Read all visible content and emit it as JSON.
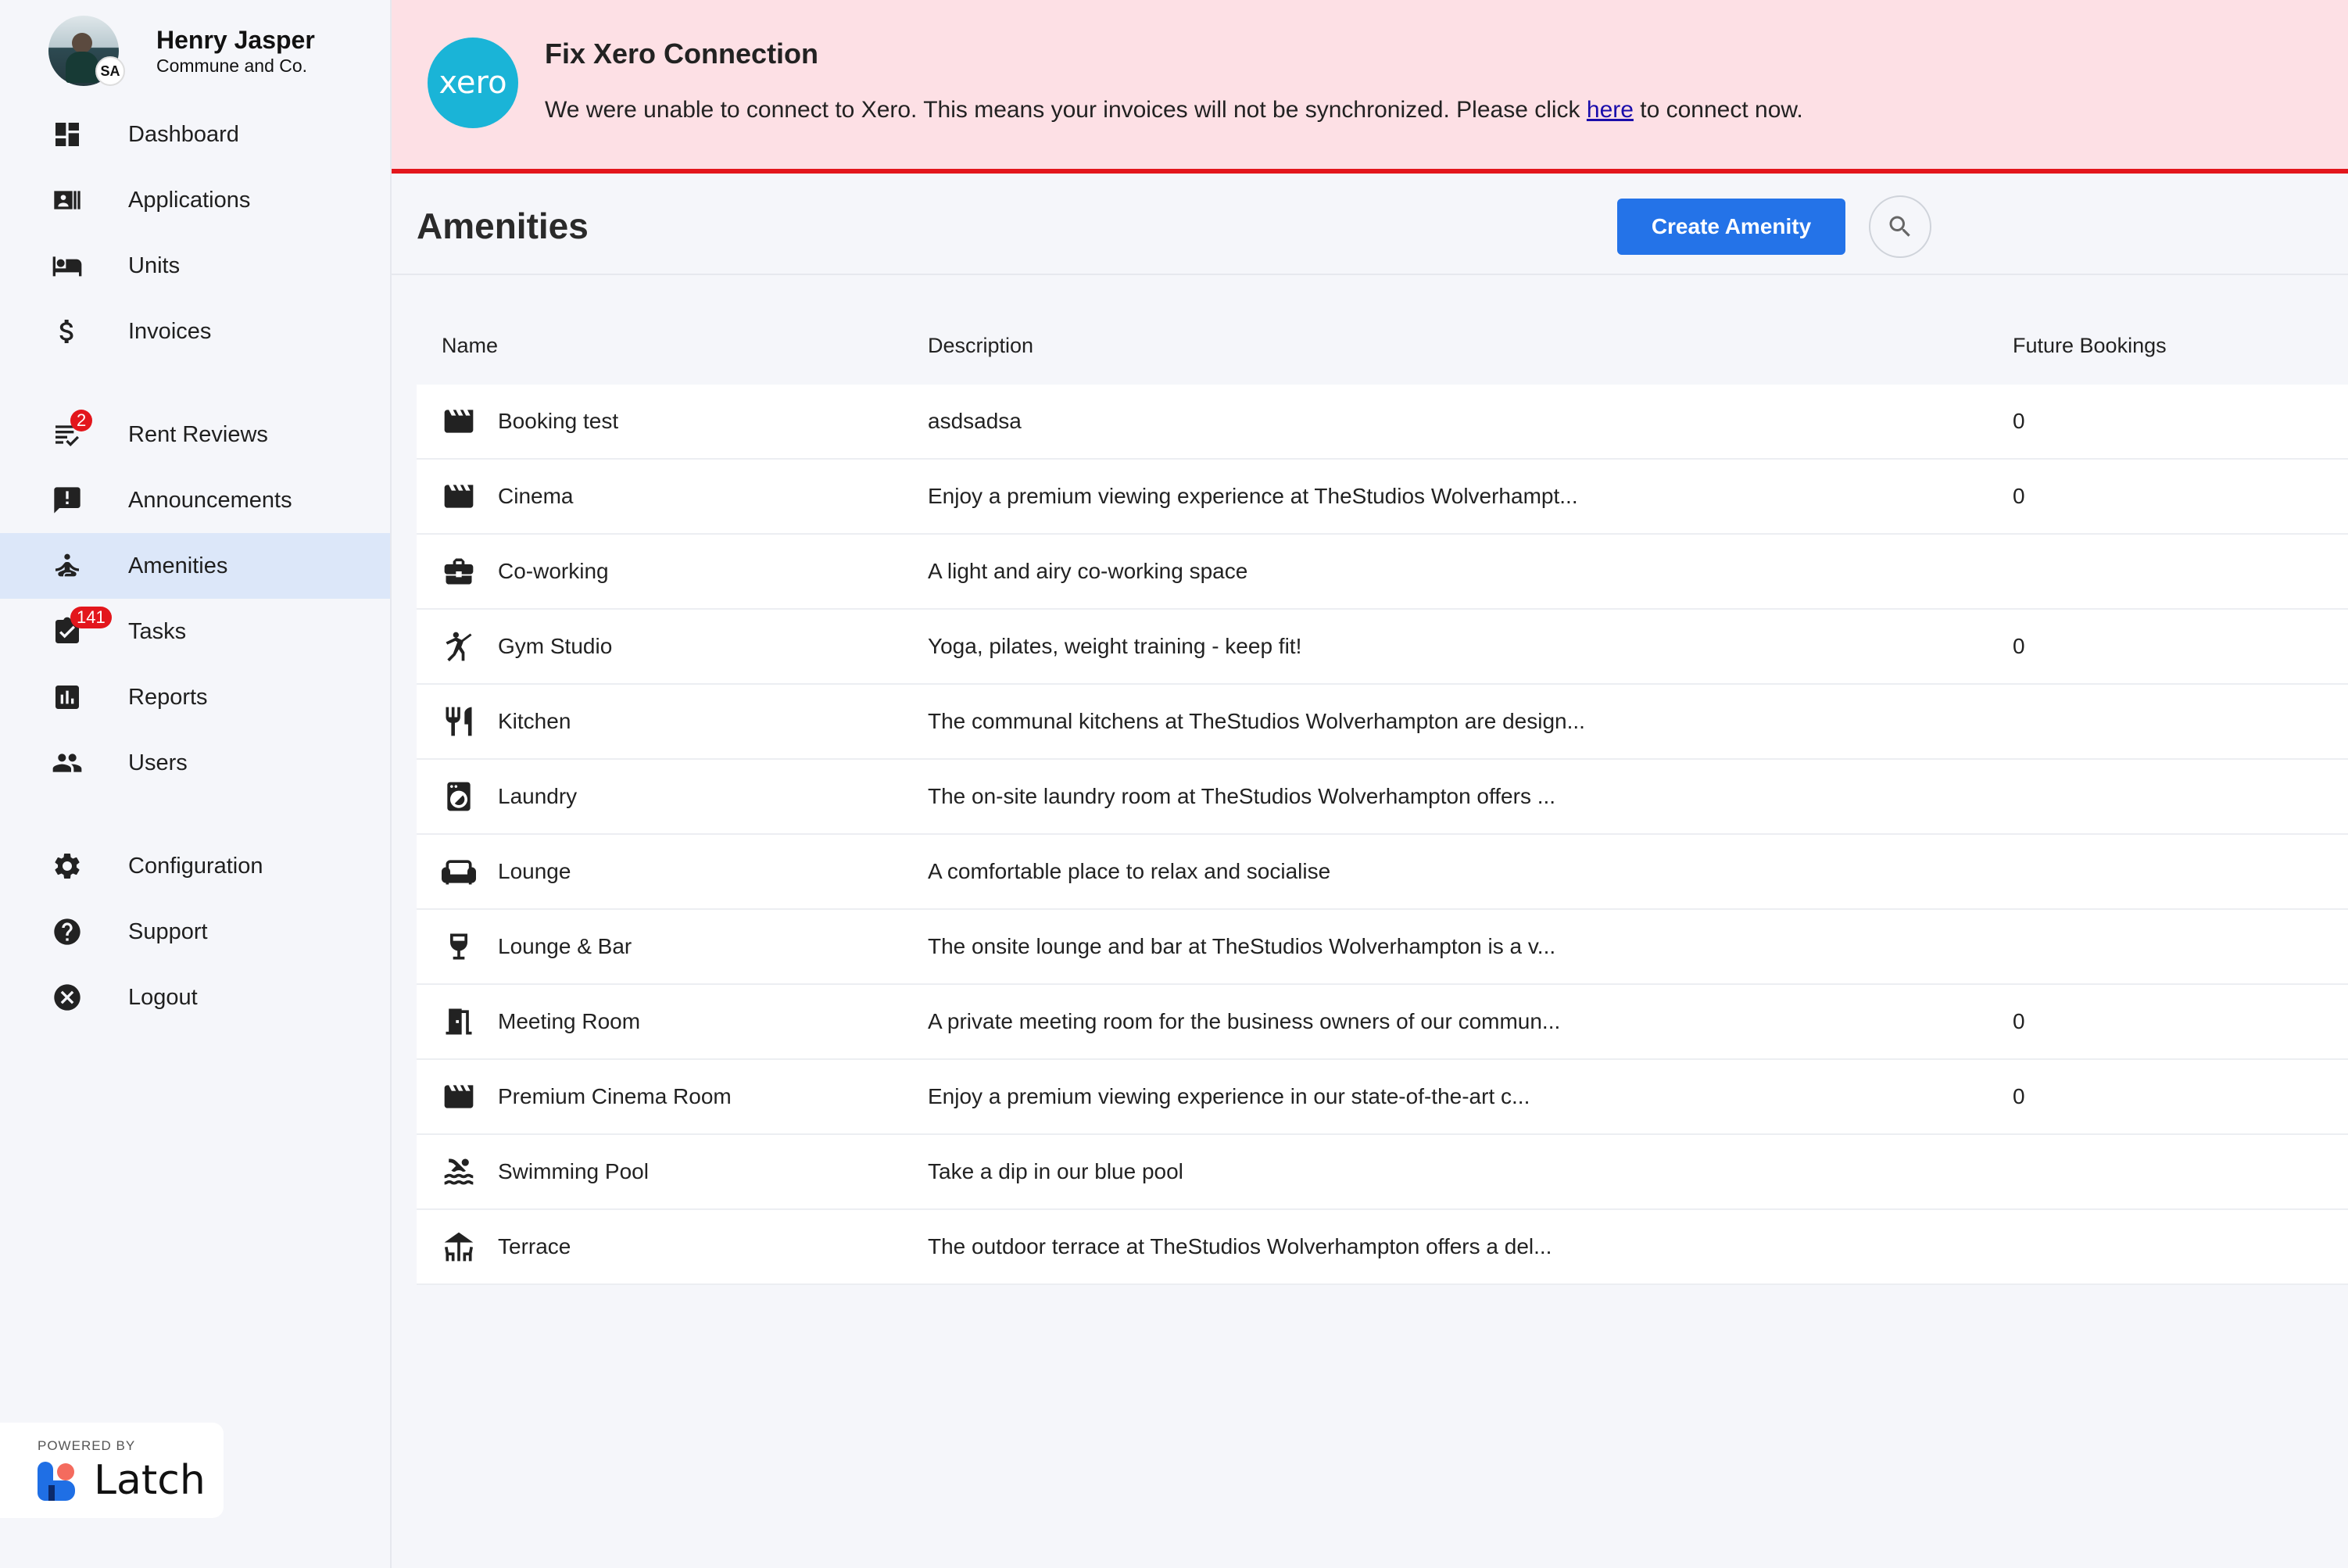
{
  "user": {
    "name": "Henry Jasper",
    "organization": "Commune and Co.",
    "badge": "SA"
  },
  "nav": {
    "dashboard": "Dashboard",
    "applications": "Applications",
    "units": "Units",
    "invoices": "Invoices",
    "rent_reviews": "Rent Reviews",
    "rent_reviews_count": "2",
    "announcements": "Announcements",
    "amenities": "Amenities",
    "tasks": "Tasks",
    "tasks_count": "141",
    "reports": "Reports",
    "users": "Users",
    "configuration": "Configuration",
    "support": "Support",
    "logout": "Logout"
  },
  "powered_by": {
    "label": "POWERED BY",
    "brand": "Latch"
  },
  "banner": {
    "logo_text": "xero",
    "title": "Fix Xero Connection",
    "message_before": "We were unable to connect to Xero. This means your invoices will not be synchronized. Please click ",
    "link_text": "here",
    "message_after": " to connect now."
  },
  "page": {
    "title": "Amenities",
    "create_button": "Create Amenity"
  },
  "table": {
    "headers": {
      "name": "Name",
      "description": "Description",
      "future_bookings": "Future Bookings"
    },
    "rows": [
      {
        "icon": "movie-icon",
        "name": "Booking test",
        "description": "asdsadsa",
        "future_bookings": "0"
      },
      {
        "icon": "movie-icon",
        "name": "Cinema",
        "description": "Enjoy a premium viewing experience at TheStudios Wolverhampt...",
        "future_bookings": "0"
      },
      {
        "icon": "briefcase-icon",
        "name": "Co-working",
        "description": "A light and airy co-working space",
        "future_bookings": ""
      },
      {
        "icon": "gymnastics-icon",
        "name": "Gym Studio",
        "description": "Yoga, pilates, weight training - keep fit!",
        "future_bookings": "0"
      },
      {
        "icon": "restaurant-icon",
        "name": "Kitchen",
        "description": "The communal kitchens at TheStudios Wolverhampton are design...",
        "future_bookings": ""
      },
      {
        "icon": "washing-machine-icon",
        "name": "Laundry",
        "description": "The on-site laundry room at TheStudios Wolverhampton offers ...",
        "future_bookings": ""
      },
      {
        "icon": "sofa-icon",
        "name": "Lounge",
        "description": "A comfortable place to relax and socialise",
        "future_bookings": ""
      },
      {
        "icon": "wine-glass-icon",
        "name": "Lounge & Bar",
        "description": "The onsite lounge and bar at TheStudios Wolverhampton is a v...",
        "future_bookings": ""
      },
      {
        "icon": "door-icon",
        "name": "Meeting Room",
        "description": "A private meeting room for the business owners of our commun...",
        "future_bookings": "0"
      },
      {
        "icon": "movie-icon",
        "name": "Premium Cinema Room",
        "description": "Enjoy a premium viewing experience in our state-of-the-art c...",
        "future_bookings": "0"
      },
      {
        "icon": "pool-icon",
        "name": "Swimming Pool",
        "description": "Take a dip in our blue pool",
        "future_bookings": ""
      },
      {
        "icon": "deck-icon",
        "name": "Terrace",
        "description": "The outdoor terrace at TheStudios Wolverhampton offers a del...",
        "future_bookings": ""
      }
    ]
  },
  "colors": {
    "accent": "#2473e8",
    "alert": "#e3161c",
    "banner_bg": "#fde0e5",
    "xero": "#1ab4d7",
    "active_nav": "#dce7f9"
  }
}
